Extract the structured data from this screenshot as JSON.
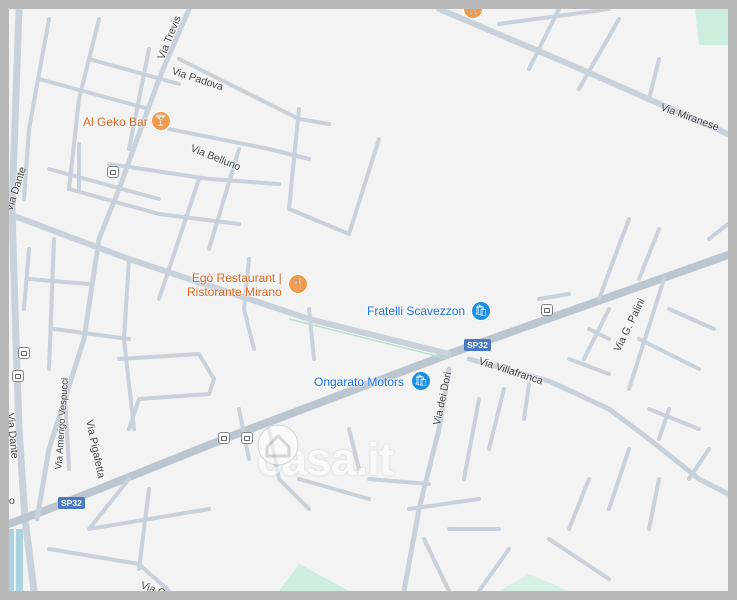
{
  "map": {
    "colors": {
      "background": "#f3f3f4",
      "road": "#c9d1da",
      "main_road": "#bcc6d1",
      "park": "#cdeedd",
      "water": "#aad3df",
      "frame": "#b9b9b9"
    },
    "streets": {
      "via_treviso": "Via Trevis",
      "via_padova": "Via Padova",
      "via_mianese": "Via Miranese",
      "via_belluno": "Via Belluno",
      "via_dante_top": "Via Dante",
      "via_dante_left": "Via Dante",
      "via_amerigo_vespucci": "Via Amerigo Vespucci",
      "via_pigafetta": "Via Pigafetta",
      "via_villafranca": "Via Villafranca",
      "via_dei_dori": "Via dei Dori",
      "via_g_palini": "Via G. Palini",
      "bottom_left_fragment": "o",
      "bottom_fragment": "Via C"
    },
    "route_shields": {
      "sp32_top": "SP32",
      "sp32_bottom": "SP32"
    },
    "places": {
      "al_geko": {
        "name": "Al Geko Bar",
        "icon": "cocktail-icon"
      },
      "ego": {
        "name_line1": "Egò Restaurant |",
        "name_line2": "Ristorante Mirano",
        "icon": "fork-knife-icon"
      },
      "fratelli": {
        "name": "Fratelli Scavezzon",
        "icon": "shopping-bag-icon"
      },
      "ongarato": {
        "name": "Ongarato Motors",
        "icon": "shopping-bag-icon"
      },
      "top_restaurant": {
        "icon": "fork-knife-icon"
      }
    },
    "transit": {
      "icon": "bus-stop-icon"
    },
    "watermark": {
      "text": "casa.it",
      "icon": "house-icon"
    }
  }
}
